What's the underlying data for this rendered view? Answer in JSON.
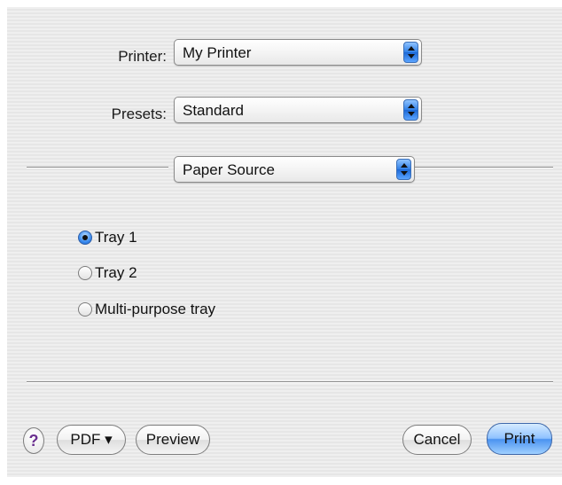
{
  "printer": {
    "label": "Printer:",
    "value": "My Printer"
  },
  "presets": {
    "label": "Presets:",
    "value": "Standard"
  },
  "section": {
    "value": "Paper Source"
  },
  "paper_source": {
    "options": [
      {
        "label": "Tray 1",
        "selected": true
      },
      {
        "label": "Tray 2",
        "selected": false
      },
      {
        "label": "Multi-purpose tray",
        "selected": false
      }
    ]
  },
  "buttons": {
    "help": "?",
    "pdf": "PDF ▾",
    "preview": "Preview",
    "cancel": "Cancel",
    "print": "Print"
  },
  "colors": {
    "accent": "#3b8cf0",
    "help_glyph": "#6a2f8f",
    "panel_background": "#ececec"
  },
  "icons": {
    "popup_arrows": "up-down-arrows-icon",
    "help": "question-mark-icon"
  }
}
